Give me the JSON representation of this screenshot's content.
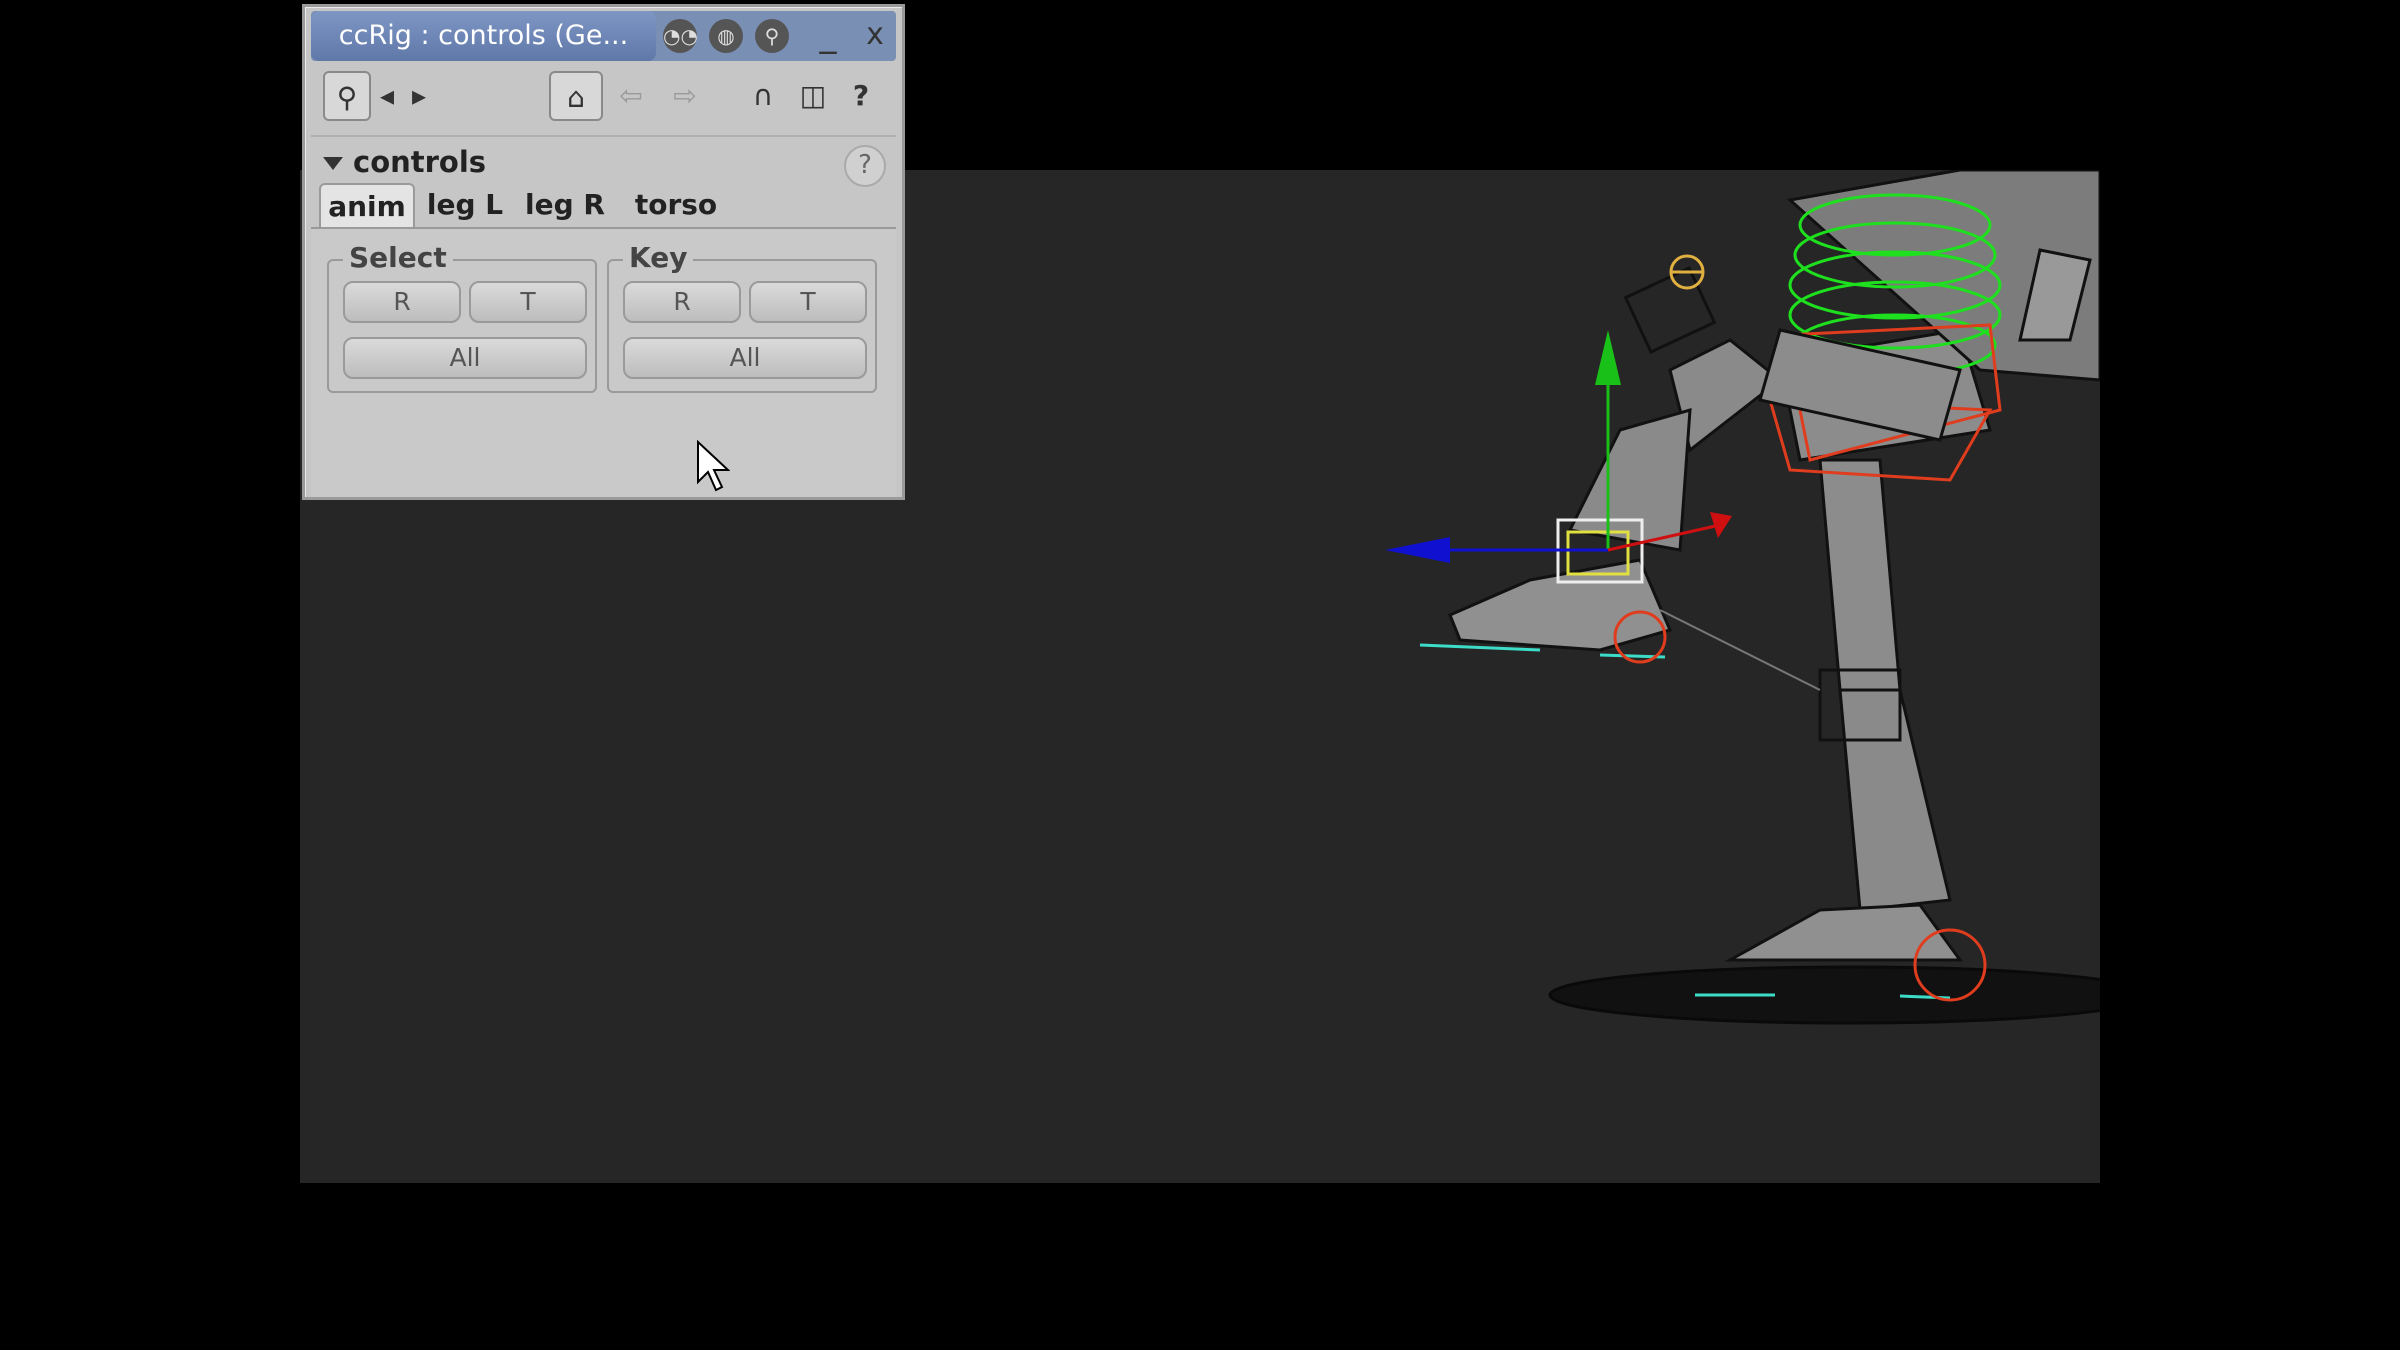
{
  "window": {
    "title": "ccRig : controls (Ge...",
    "title_icons": [
      "eyes-icon",
      "globe-icon",
      "person-icon"
    ],
    "minimize_label": "_",
    "close_label": "x"
  },
  "toolbar": {
    "search_icon": "magnifier-icon",
    "prev_label": "◂",
    "next_label": "▸",
    "home_icon": "home-icon",
    "back_icon": "arrow-left-icon",
    "forward_icon": "arrow-right-icon",
    "magnet_icon": "magnet-icon",
    "cube_icon": "cube-icon",
    "help_label": "?"
  },
  "section": {
    "title": "controls",
    "help_label": "?"
  },
  "tabs": [
    {
      "label": "anim",
      "active": true
    },
    {
      "label": "leg L",
      "active": false
    },
    {
      "label": "leg R",
      "active": false
    },
    {
      "label": "torso",
      "active": false
    }
  ],
  "select_group": {
    "label": "Select",
    "r_label": "R",
    "t_label": "T",
    "all_label": "All"
  },
  "key_group": {
    "label": "Key",
    "r_label": "R",
    "t_label": "T",
    "all_label": "All"
  },
  "colors": {
    "viewport_bg": "#262626",
    "manip_x": "#d01010",
    "manip_y": "#18c018",
    "manip_z": "#1010d0",
    "curve_green": "#1ee01e",
    "curve_red": "#e03c1e",
    "curve_cyan": "#3cdcc8",
    "mesh": "#8c8c8c"
  }
}
